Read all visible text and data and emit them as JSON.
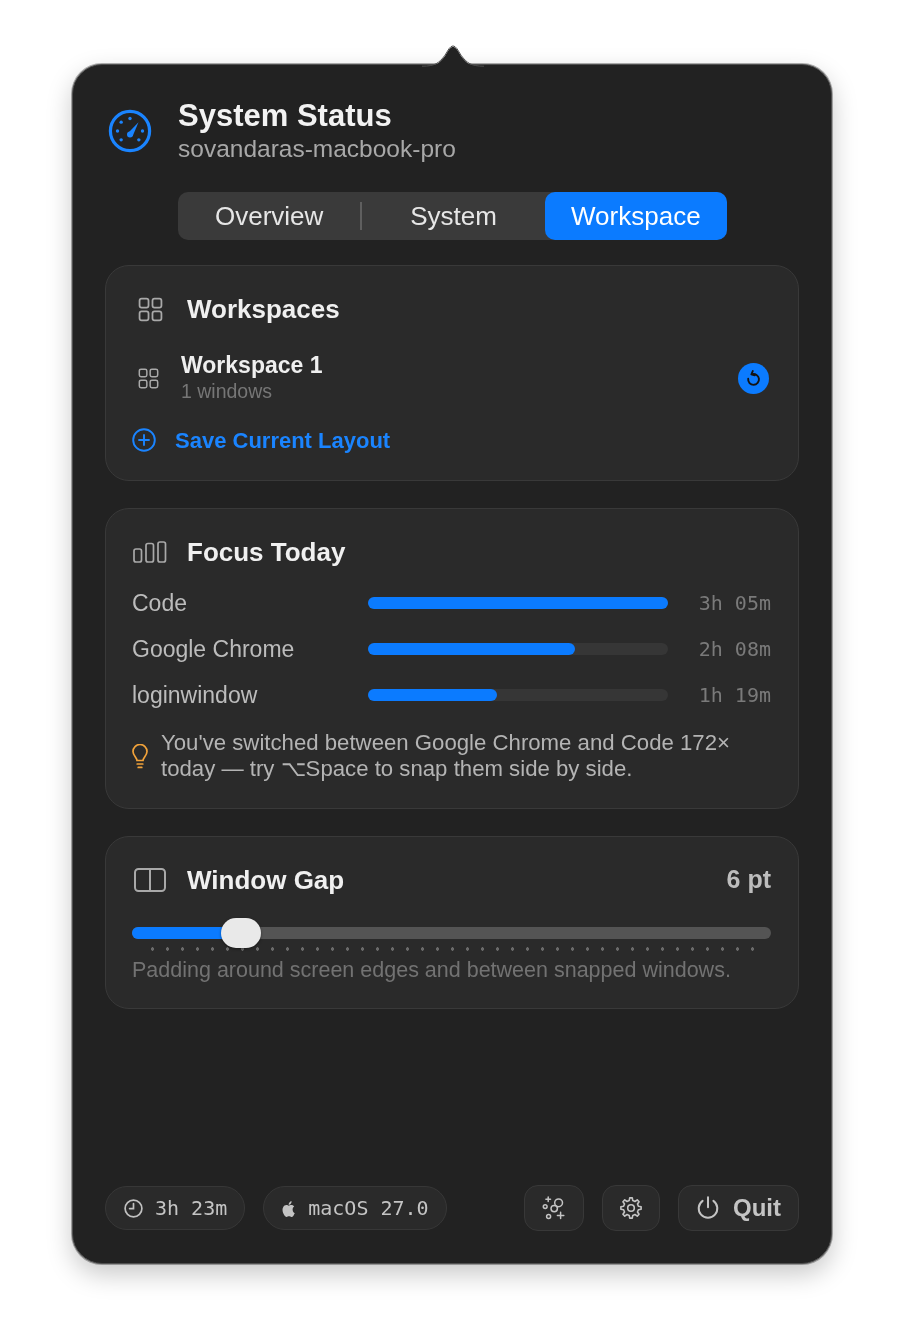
{
  "header": {
    "title": "System Status",
    "subtitle": "sovandaras-macbook-pro"
  },
  "tabs": [
    {
      "label": "Overview",
      "selected": false
    },
    {
      "label": "System",
      "selected": false
    },
    {
      "label": "Workspace",
      "selected": true
    }
  ],
  "workspaces": {
    "title": "Workspaces",
    "items": [
      {
        "name": "Workspace 1",
        "detail": "1 windows"
      }
    ],
    "save_label": "Save Current Layout"
  },
  "focus_today": {
    "title": "Focus Today",
    "apps": [
      {
        "name": "Code",
        "level": 1,
        "duration": "3h 05m"
      },
      {
        "name": "Google Chrome",
        "level": 0.69,
        "duration": "2h 08m"
      },
      {
        "name": "loginwindow",
        "level": 0.43,
        "duration": "1h 19m"
      }
    ],
    "tip": "You've switched between Google Chrome and Code 172× today — try ⌥Space to snap them side by side."
  },
  "window_gap": {
    "title": "Window Gap",
    "value": "6 pt",
    "slider": {
      "level": 0.17
    },
    "description": "Padding around screen edges and between snapped windows."
  },
  "footer": {
    "chips": [
      {
        "kind": "uptime",
        "text": "3h 23m"
      },
      {
        "kind": "os",
        "text": "macOS 27.0"
      }
    ],
    "quit_label": "Quit"
  }
}
